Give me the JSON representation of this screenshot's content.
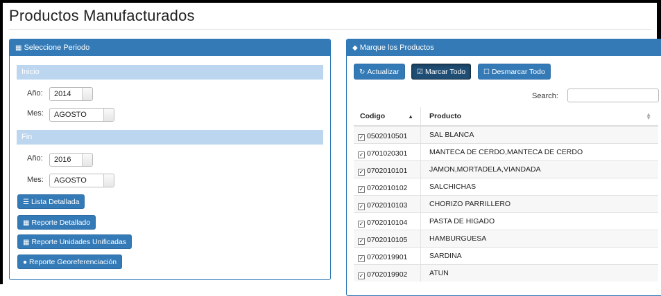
{
  "page": {
    "title": "Productos Manufacturados"
  },
  "period_panel": {
    "header": "Seleccione Periodo",
    "inicio": {
      "label": "Inicio",
      "year_label": "Año:",
      "year": "2014",
      "month_label": "Mes:",
      "month": "AGOSTO"
    },
    "fin": {
      "label": "Fin",
      "year_label": "Año:",
      "year": "2016",
      "month_label": "Mes:",
      "month": "AGOSTO"
    },
    "buttons": {
      "lista": "Lista Detallada",
      "reporte": "Reporte Detallado",
      "unidades": "Reporte Unidades Unificadas",
      "geo": "Reporte Georeferenciación"
    }
  },
  "products_panel": {
    "header": "Marque los Productos",
    "buttons": {
      "actualizar": "Actualizar",
      "marcar": "Marcar Todo",
      "desmarcar": "Desmarcar Todo"
    },
    "search_label": "Search:",
    "search_value": "",
    "columns": {
      "codigo": "Codigo",
      "producto": "Producto"
    },
    "rows": [
      {
        "codigo": "0502010501",
        "producto": "SAL BLANCA"
      },
      {
        "codigo": "0701020301",
        "producto": "MANTECA DE CERDO,MANTECA DE CERDO"
      },
      {
        "codigo": "0702010101",
        "producto": "JAMON,MORTADELA,VIANDADA"
      },
      {
        "codigo": "0702010102",
        "producto": "SALCHICHAS"
      },
      {
        "codigo": "0702010103",
        "producto": "CHORIZO PARRILLERO"
      },
      {
        "codigo": "0702010104",
        "producto": "PASTA DE HIGADO"
      },
      {
        "codigo": "0702010105",
        "producto": "HAMBURGUESA"
      },
      {
        "codigo": "0702019901",
        "producto": "SARDINA"
      },
      {
        "codigo": "0702019902",
        "producto": "ATUN"
      }
    ]
  },
  "colors": {
    "primary": "#337ab7",
    "band": "#bcd6f0",
    "active_button": "#204d74"
  }
}
